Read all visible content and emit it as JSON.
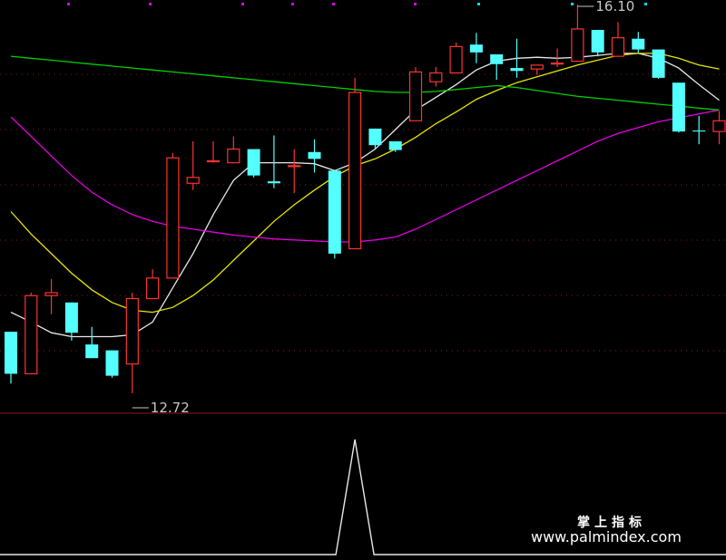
{
  "chart_data": {
    "type": "candlestick",
    "price_labels": {
      "low": "12.72",
      "high": "16.10"
    },
    "candles": [
      {
        "o": 13.25,
        "h": 13.25,
        "l": 12.72,
        "c": 12.82
      },
      {
        "o": 12.82,
        "h": 13.65,
        "l": 12.82,
        "c": 13.62
      },
      {
        "o": 13.62,
        "h": 13.79,
        "l": 13.43,
        "c": 13.65
      },
      {
        "o": 13.55,
        "h": 13.55,
        "l": 13.16,
        "c": 13.24
      },
      {
        "o": 13.12,
        "h": 13.3,
        "l": 12.98,
        "c": 12.98
      },
      {
        "o": 13.06,
        "h": 13.06,
        "l": 12.78,
        "c": 12.8
      },
      {
        "o": 12.92,
        "h": 13.65,
        "l": 12.62,
        "c": 13.59
      },
      {
        "o": 13.59,
        "h": 13.89,
        "l": 13.59,
        "c": 13.8
      },
      {
        "o": 13.8,
        "h": 15.08,
        "l": 13.8,
        "c": 15.03
      },
      {
        "o": 14.77,
        "h": 15.2,
        "l": 14.7,
        "c": 14.83
      },
      {
        "o": 15.0,
        "h": 15.2,
        "l": 14.98,
        "c": 15.0
      },
      {
        "o": 14.98,
        "h": 15.25,
        "l": 14.98,
        "c": 15.12
      },
      {
        "o": 15.12,
        "h": 15.12,
        "l": 14.83,
        "c": 14.85
      },
      {
        "o": 14.79,
        "h": 15.26,
        "l": 14.72,
        "c": 14.77
      },
      {
        "o": 14.95,
        "h": 15.12,
        "l": 14.67,
        "c": 14.95
      },
      {
        "o": 15.09,
        "h": 15.22,
        "l": 14.88,
        "c": 15.02
      },
      {
        "o": 14.9,
        "h": 14.9,
        "l": 14.0,
        "c": 14.05
      },
      {
        "o": 14.1,
        "h": 15.85,
        "l": 14.1,
        "c": 15.7
      },
      {
        "o": 15.33,
        "h": 15.33,
        "l": 15.12,
        "c": 15.16
      },
      {
        "o": 15.2,
        "h": 15.2,
        "l": 15.09,
        "c": 15.11
      },
      {
        "o": 15.41,
        "h": 15.96,
        "l": 15.41,
        "c": 15.91
      },
      {
        "o": 15.81,
        "h": 15.96,
        "l": 15.76,
        "c": 15.9
      },
      {
        "o": 15.9,
        "h": 16.21,
        "l": 15.9,
        "c": 16.17
      },
      {
        "o": 16.19,
        "h": 16.31,
        "l": 16.0,
        "c": 16.11
      },
      {
        "o": 16.09,
        "h": 16.09,
        "l": 15.83,
        "c": 15.99
      },
      {
        "o": 15.95,
        "h": 16.25,
        "l": 15.85,
        "c": 15.92
      },
      {
        "o": 15.94,
        "h": 15.98,
        "l": 15.88,
        "c": 15.98
      },
      {
        "o": 16.0,
        "h": 16.15,
        "l": 15.96,
        "c": 16.0
      },
      {
        "o": 16.02,
        "h": 16.6,
        "l": 16.02,
        "c": 16.35
      },
      {
        "o": 16.34,
        "h": 16.34,
        "l": 16.07,
        "c": 16.11
      },
      {
        "o": 16.07,
        "h": 16.42,
        "l": 16.07,
        "c": 16.26
      },
      {
        "o": 16.25,
        "h": 16.32,
        "l": 16.1,
        "c": 16.14
      },
      {
        "o": 16.14,
        "h": 16.14,
        "l": 15.84,
        "c": 15.85
      },
      {
        "o": 15.8,
        "h": 15.8,
        "l": 15.29,
        "c": 15.3
      },
      {
        "o": 15.31,
        "h": 15.46,
        "l": 15.17,
        "c": 15.3
      },
      {
        "o": 15.3,
        "h": 15.51,
        "l": 15.17,
        "c": 15.41
      }
    ],
    "ma_series": [
      {
        "color": "#e8e8e8",
        "values": [
          13.45,
          13.35,
          13.24,
          13.2,
          13.2,
          13.2,
          13.22,
          13.35,
          13.7,
          14.05,
          14.45,
          14.8,
          14.98,
          14.98,
          14.98,
          14.97,
          14.9,
          14.98,
          15.12,
          15.32,
          15.52,
          15.65,
          15.78,
          15.93,
          16.02,
          16.05,
          16.06,
          16.05,
          16.06,
          16.08,
          16.1,
          16.1,
          16.05,
          15.95,
          15.78,
          15.62
        ]
      },
      {
        "color": "#e6e600",
        "values": [
          14.48,
          14.25,
          14.05,
          13.85,
          13.68,
          13.55,
          13.47,
          13.45,
          13.5,
          13.62,
          13.78,
          13.98,
          14.18,
          14.38,
          14.55,
          14.7,
          14.84,
          14.95,
          15.02,
          15.12,
          15.24,
          15.38,
          15.5,
          15.63,
          15.72,
          15.8,
          15.86,
          15.92,
          15.98,
          16.03,
          16.08,
          16.1,
          16.1,
          16.05,
          15.98,
          15.94
        ]
      },
      {
        "color": "#e000e0",
        "values": [
          15.45,
          15.25,
          15.05,
          14.85,
          14.68,
          14.55,
          14.45,
          14.38,
          14.33,
          14.3,
          14.27,
          14.24,
          14.22,
          14.2,
          14.19,
          14.18,
          14.17,
          14.17,
          14.19,
          14.22,
          14.3,
          14.4,
          14.5,
          14.6,
          14.7,
          14.8,
          14.9,
          15.0,
          15.1,
          15.2,
          15.28,
          15.34,
          15.4,
          15.44,
          15.48,
          15.52
        ]
      },
      {
        "color": "#00d000",
        "values": [
          16.07,
          16.05,
          16.03,
          16.01,
          15.99,
          15.97,
          15.95,
          15.93,
          15.91,
          15.89,
          15.87,
          15.85,
          15.83,
          15.81,
          15.79,
          15.77,
          15.75,
          15.73,
          15.71,
          15.7,
          15.7,
          15.71,
          15.73,
          15.75,
          15.77,
          15.75,
          15.72,
          15.69,
          15.66,
          15.64,
          15.62,
          15.6,
          15.58,
          15.56,
          15.54,
          15.52
        ]
      }
    ],
    "signal": {
      "spike_index": 17,
      "value": 1
    }
  },
  "watermark": {
    "title": "掌上指标",
    "url": "www.palmindex.com"
  }
}
